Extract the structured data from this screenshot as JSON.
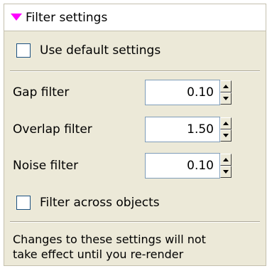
{
  "header": {
    "title": "Filter settings",
    "expand_icon": "triangle-down-icon",
    "icon_color": "#ff00ff"
  },
  "use_default": {
    "label": "Use default settings",
    "checked": false
  },
  "filters": [
    {
      "label": "Gap filter",
      "value": "0.10"
    },
    {
      "label": "Overlap filter",
      "value": "1.50"
    },
    {
      "label": "Noise filter",
      "value": "0.10"
    }
  ],
  "across_objects": {
    "label": "Filter across objects",
    "checked": false
  },
  "note": {
    "line1": "Changes to these settings will not",
    "line2": "take effect until you re-render"
  }
}
